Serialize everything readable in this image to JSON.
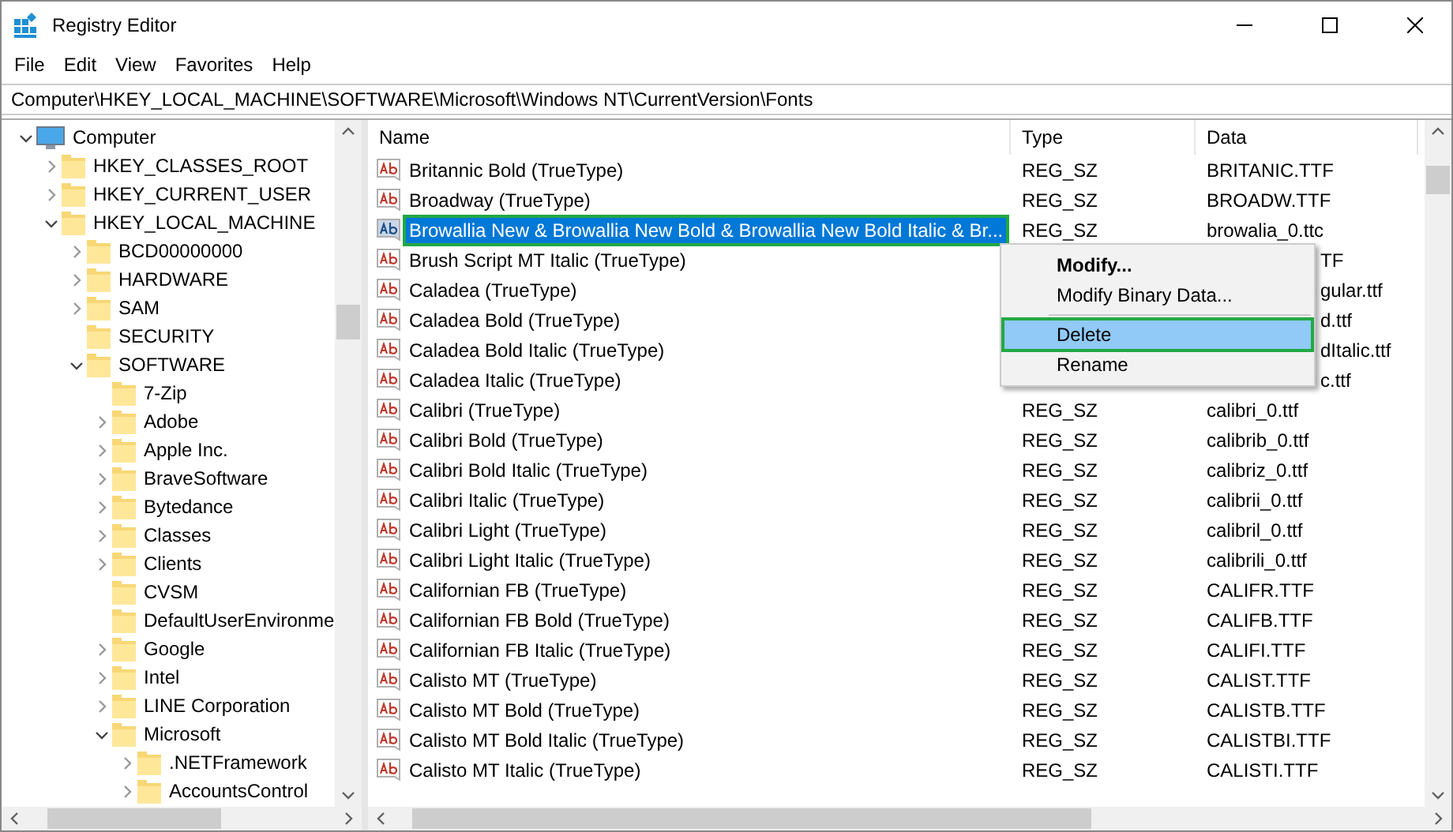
{
  "window": {
    "title": "Registry Editor"
  },
  "menu": [
    "File",
    "Edit",
    "View",
    "Favorites",
    "Help"
  ],
  "address": "Computer\\HKEY_LOCAL_MACHINE\\SOFTWARE\\Microsoft\\Windows NT\\CurrentVersion\\Fonts",
  "tree": [
    {
      "label": "Computer",
      "kind": "computer",
      "expanded": true,
      "children": [
        {
          "label": "HKEY_CLASSES_ROOT",
          "kind": "folder",
          "expanded": false
        },
        {
          "label": "HKEY_CURRENT_USER",
          "kind": "folder",
          "expanded": false
        },
        {
          "label": "HKEY_LOCAL_MACHINE",
          "kind": "folder",
          "expanded": true,
          "children": [
            {
              "label": "BCD00000000",
              "kind": "folder",
              "expanded": false
            },
            {
              "label": "HARDWARE",
              "kind": "folder",
              "expanded": false
            },
            {
              "label": "SAM",
              "kind": "folder",
              "expanded": false
            },
            {
              "label": "SECURITY",
              "kind": "folder"
            },
            {
              "label": "SOFTWARE",
              "kind": "folder",
              "expanded": true,
              "children": [
                {
                  "label": "7-Zip",
                  "kind": "folder"
                },
                {
                  "label": "Adobe",
                  "kind": "folder",
                  "expanded": false
                },
                {
                  "label": "Apple Inc.",
                  "kind": "folder",
                  "expanded": false
                },
                {
                  "label": "BraveSoftware",
                  "kind": "folder",
                  "expanded": false
                },
                {
                  "label": "Bytedance",
                  "kind": "folder",
                  "expanded": false
                },
                {
                  "label": "Classes",
                  "kind": "folder",
                  "expanded": false
                },
                {
                  "label": "Clients",
                  "kind": "folder",
                  "expanded": false
                },
                {
                  "label": "CVSM",
                  "kind": "folder"
                },
                {
                  "label": "DefaultUserEnvironme",
                  "kind": "folder"
                },
                {
                  "label": "Google",
                  "kind": "folder",
                  "expanded": false
                },
                {
                  "label": "Intel",
                  "kind": "folder",
                  "expanded": false
                },
                {
                  "label": "LINE Corporation",
                  "kind": "folder",
                  "expanded": false
                },
                {
                  "label": "Microsoft",
                  "kind": "folder",
                  "expanded": true,
                  "children": [
                    {
                      "label": ".NETFramework",
                      "kind": "folder",
                      "expanded": false
                    },
                    {
                      "label": "AccountsControl",
                      "kind": "folder",
                      "expanded": false
                    }
                  ]
                }
              ]
            }
          ]
        }
      ]
    }
  ],
  "table": {
    "columns": [
      "Name",
      "Type",
      "Data"
    ],
    "rows": [
      {
        "name": "Britannic Bold (TrueType)",
        "kind": "full",
        "type": "REG_SZ",
        "data": "BRITANIC.TTF",
        "selected": false
      },
      {
        "name": "Broadway (TrueType)",
        "kind": "full",
        "type": "REG_SZ",
        "data": "BROADW.TTF",
        "selected": false
      },
      {
        "name": "Browallia New & Browallia New Bold & Browallia New Bold Italic & Br...",
        "kind": "full",
        "type": "REG_SZ",
        "data": "browalia_0.ttc",
        "selected": true
      },
      {
        "name": "Brush Script MT Italic (TrueType)",
        "kind": "partial",
        "data": "TF",
        "selected": false
      },
      {
        "name": "Caladea (TrueType)",
        "kind": "partial",
        "data": "gular.ttf",
        "selected": false
      },
      {
        "name": "Caladea Bold (TrueType)",
        "kind": "partial",
        "data": "d.ttf",
        "selected": false
      },
      {
        "name": "Caladea Bold Italic (TrueType)",
        "kind": "partial",
        "data": "dItalic.ttf",
        "selected": false
      },
      {
        "name": "Caladea Italic (TrueType)",
        "kind": "partial",
        "data": "c.ttf",
        "selected": false
      },
      {
        "name": "Calibri (TrueType)",
        "kind": "full",
        "type": "REG_SZ",
        "data": "calibri_0.ttf",
        "selected": false
      },
      {
        "name": "Calibri Bold (TrueType)",
        "kind": "full",
        "type": "REG_SZ",
        "data": "calibrib_0.ttf",
        "selected": false
      },
      {
        "name": "Calibri Bold Italic (TrueType)",
        "kind": "full",
        "type": "REG_SZ",
        "data": "calibriz_0.ttf",
        "selected": false
      },
      {
        "name": "Calibri Italic (TrueType)",
        "kind": "full",
        "type": "REG_SZ",
        "data": "calibrii_0.ttf",
        "selected": false
      },
      {
        "name": "Calibri Light (TrueType)",
        "kind": "full",
        "type": "REG_SZ",
        "data": "calibril_0.ttf",
        "selected": false
      },
      {
        "name": "Calibri Light Italic (TrueType)",
        "kind": "full",
        "type": "REG_SZ",
        "data": "calibrili_0.ttf",
        "selected": false
      },
      {
        "name": "Californian FB (TrueType)",
        "kind": "full",
        "type": "REG_SZ",
        "data": "CALIFR.TTF",
        "selected": false
      },
      {
        "name": "Californian FB Bold (TrueType)",
        "kind": "full",
        "type": "REG_SZ",
        "data": "CALIFB.TTF",
        "selected": false
      },
      {
        "name": "Californian FB Italic (TrueType)",
        "kind": "full",
        "type": "REG_SZ",
        "data": "CALIFI.TTF",
        "selected": false
      },
      {
        "name": "Calisto MT (TrueType)",
        "kind": "full",
        "type": "REG_SZ",
        "data": "CALIST.TTF",
        "selected": false
      },
      {
        "name": "Calisto MT Bold (TrueType)",
        "kind": "full",
        "type": "REG_SZ",
        "data": "CALISTB.TTF",
        "selected": false
      },
      {
        "name": "Calisto MT Bold Italic (TrueType)",
        "kind": "full",
        "type": "REG_SZ",
        "data": "CALISTBI.TTF",
        "selected": false
      },
      {
        "name": "Calisto MT Italic (TrueType)",
        "kind": "full",
        "type": "REG_SZ",
        "data": "CALISTI.TTF",
        "selected": false
      }
    ]
  },
  "context_menu": [
    {
      "label": "Modify...",
      "kind": "default",
      "selected": false
    },
    {
      "label": "Modify Binary Data...",
      "kind": "item",
      "selected": false
    },
    {
      "kind": "separator"
    },
    {
      "label": "Delete",
      "kind": "item",
      "selected": true
    },
    {
      "label": "Rename",
      "kind": "item",
      "selected": false
    }
  ]
}
